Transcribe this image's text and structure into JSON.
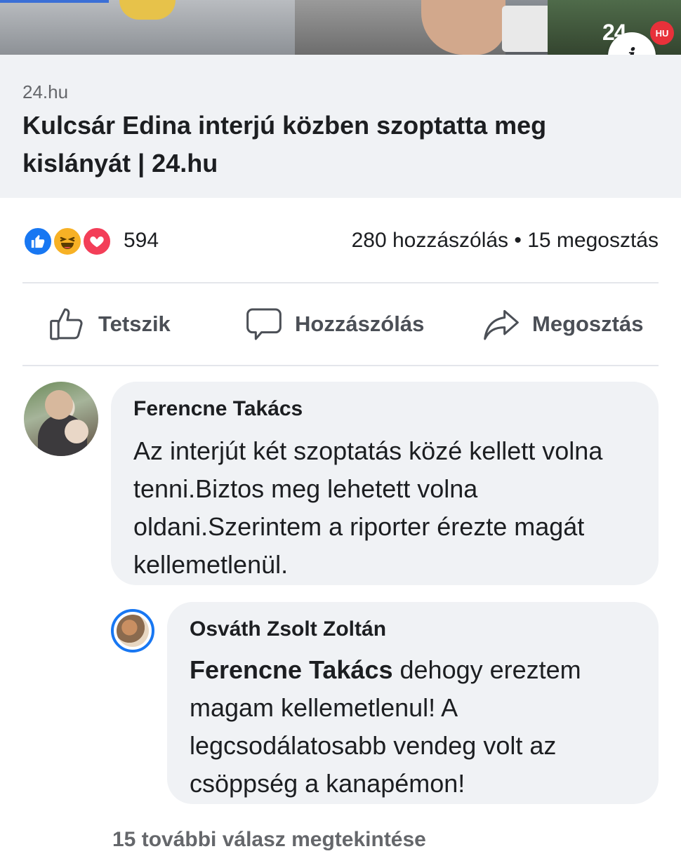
{
  "link_preview": {
    "image_logo_text": "24",
    "image_badge": "HU",
    "info_icon": "info-icon",
    "domain": "24.hu",
    "title": "Kulcsár Edina interjú közben szoptatta meg kislányát | 24.hu"
  },
  "reactions": {
    "icons": [
      "like-reaction-icon",
      "haha-reaction-icon",
      "love-reaction-icon"
    ],
    "count": "594",
    "engagement": "280 hozzászólás • 15 megosztás"
  },
  "actions": {
    "like_label": "Tetszik",
    "comment_label": "Hozzászólás",
    "share_label": "Megosztás"
  },
  "comments": [
    {
      "author": "Ferencne Takács",
      "text": "Az interjút két szoptatás közé kellett volna tenni.Biztos meg lehetett volna oldani.Szerintem a riporter érezte magát kellemetlenül."
    }
  ],
  "reply": {
    "author": "Osváth Zsolt Zoltán",
    "mention": "Ferencne Takács",
    "text": " dehogy ereztem magam kellemetlenul! A legcsodálatosabb vendeg volt az csöppség a kanapémon!"
  },
  "more_replies": "15 további válasz megtekintése",
  "colors": {
    "accent": "#1877f2",
    "bubble": "#f0f2f5",
    "muted_text": "#65676b"
  }
}
